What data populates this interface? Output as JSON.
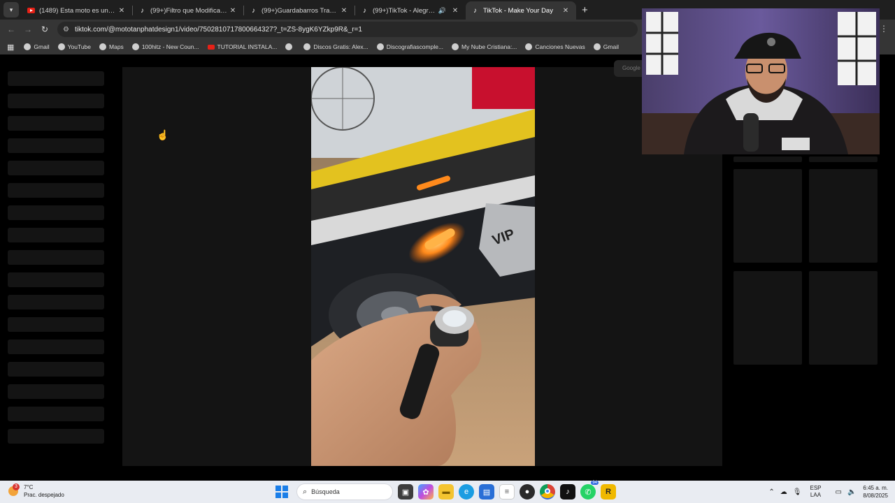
{
  "browser": {
    "tabs": [
      {
        "title": "(1489) Esta moto es una delicia",
        "favicon": "youtube-icon"
      },
      {
        "title": "(99+)Filtro que Modifica tu Mot",
        "favicon": "tiktok-icon"
      },
      {
        "title": "(99+)Guardabarros Trasero Uni",
        "favicon": "tiktok-icon"
      },
      {
        "title": "(99+)TikTok - Alegra tu día",
        "favicon": "tiktok-icon",
        "audible": true
      },
      {
        "title": "TikTok - Make Your Day",
        "favicon": "tiktok-icon",
        "active": true
      }
    ],
    "new_tab_glyph": "+",
    "url": "tiktok.com/@mototanphatdesign1/video/7502810717800664327?_t=ZS-8ygK6YZkp9R&_r=1",
    "bookmarks": [
      {
        "label": "Gmail"
      },
      {
        "label": "YouTube"
      },
      {
        "label": "Maps"
      },
      {
        "label": "100hitz - New Coun..."
      },
      {
        "label": "TUTORIAL INSTALA...",
        "red": true
      },
      {
        "label": ""
      },
      {
        "label": "Discos Gratis: Alex..."
      },
      {
        "label": "Discografiascomple..."
      },
      {
        "label": "My Nube Cristiana:..."
      },
      {
        "label": "Canciones Nuevas"
      },
      {
        "label": "Gmail"
      }
    ],
    "ghost_popup": "Google"
  },
  "taskbar": {
    "weather_temp": "7°C",
    "weather_desc": "Prac. despejado",
    "weather_badge": "3",
    "search_placeholder": "Búsqueda",
    "whatsapp_badge": "94",
    "lang_line1": "ESP",
    "lang_line2": "LAA",
    "time": "6:45 a. m.",
    "date": "8/08/2025"
  },
  "colors": {
    "chrome_bg": "#353535",
    "page_bg": "#000000",
    "skeleton": "#141414",
    "taskbar_bg": "#e9ecf2",
    "accent_blue": "#1a7ee8"
  }
}
